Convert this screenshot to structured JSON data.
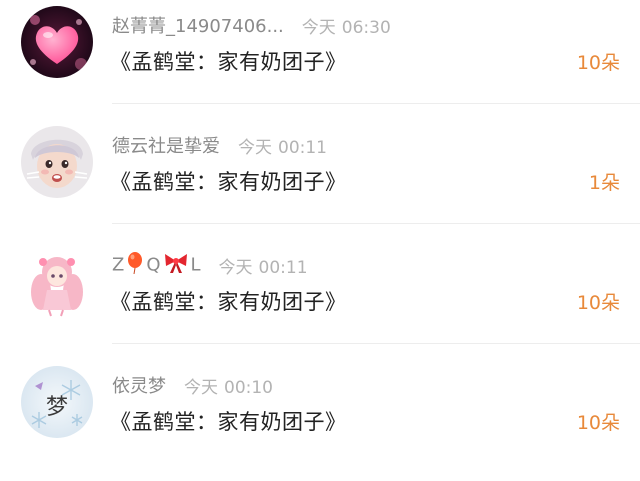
{
  "comments": [
    {
      "name": "赵菁菁_14907406...",
      "time_day": "今天",
      "time_clock": "06:30",
      "content": "《孟鹤堂：家有奶团子》",
      "gift_count": "10朵",
      "avatar_icon": "pink-heart-avatar"
    },
    {
      "name": "德云社是挚爱",
      "time_day": "今天",
      "time_clock": "00:11",
      "content": "《孟鹤堂：家有奶团子》",
      "gift_count": "1朵",
      "avatar_icon": "person-photo-avatar"
    },
    {
      "name_parts": [
        "Z",
        "Q",
        "L"
      ],
      "name_icons": [
        "balloon-icon",
        "bow-icon"
      ],
      "time_day": "今天",
      "time_clock": "00:11",
      "content": "《孟鹤堂：家有奶团子》",
      "gift_count": "10朵",
      "avatar_icon": "anime-girl-avatar"
    },
    {
      "name": "依灵梦",
      "time_day": "今天",
      "time_clock": "00:10",
      "content": "《孟鹤堂：家有奶团子》",
      "gift_count": "10朵",
      "avatar_icon": "snowflake-text-avatar",
      "avatar_text": "梦"
    }
  ],
  "colors": {
    "name": "#8a8a8a",
    "time": "#b3b3b3",
    "content": "#222222",
    "gift_count": "#e8893a",
    "divider": "#ededed"
  }
}
